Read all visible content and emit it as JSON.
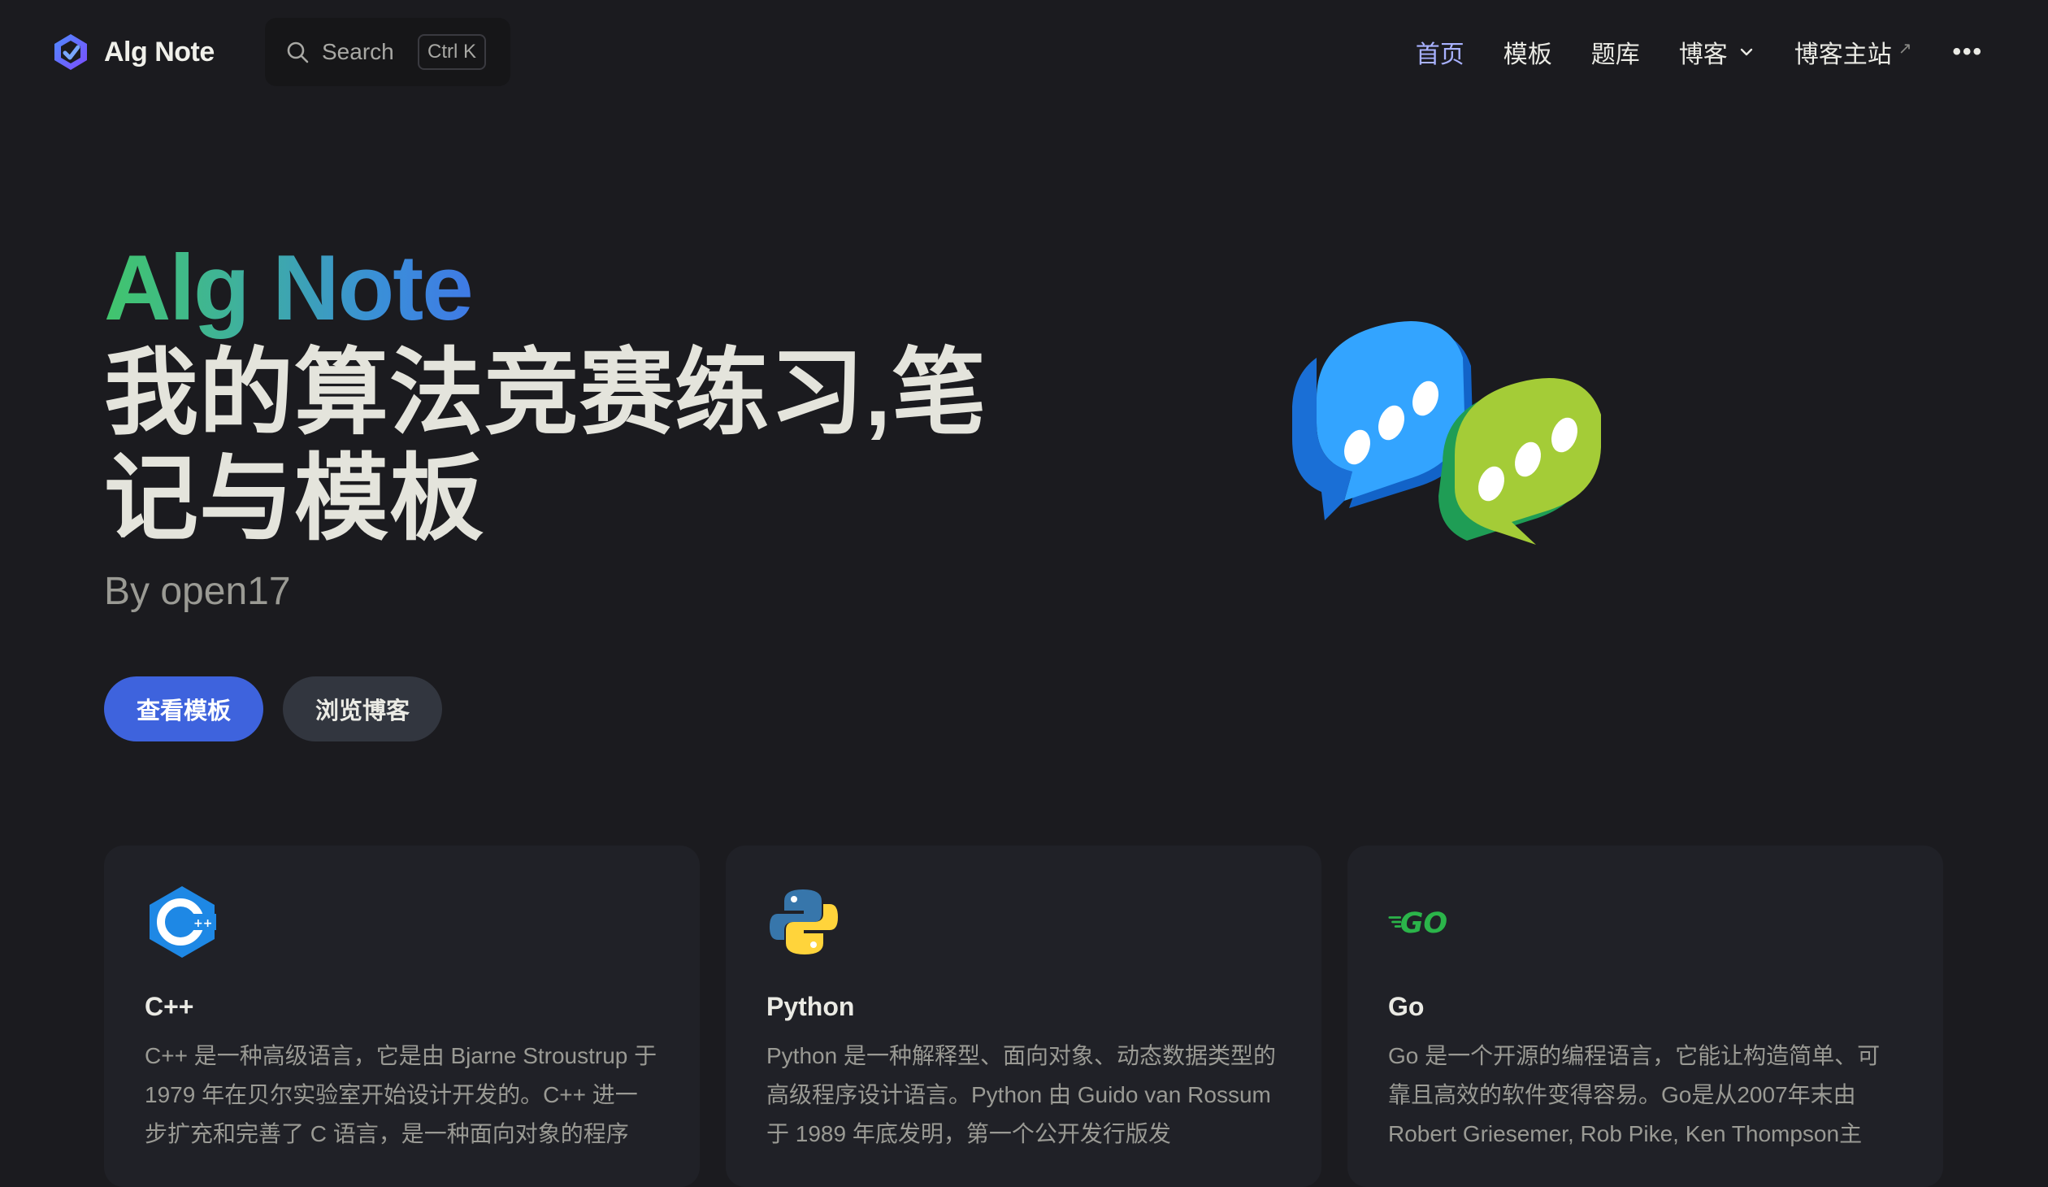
{
  "nav": {
    "brand": "Alg Note",
    "search_label": "Search",
    "search_kbd": "Ctrl K",
    "links": [
      {
        "label": "首页",
        "active": true
      },
      {
        "label": "模板"
      },
      {
        "label": "题库"
      },
      {
        "label": "博客",
        "dropdown": true
      },
      {
        "label": "博客主站",
        "external": true
      }
    ],
    "more": "•••"
  },
  "hero": {
    "name": "Alg Note",
    "text": "我的算法竞赛练习,笔记与模板",
    "tagline": "By open17",
    "actions": [
      {
        "label": "查看模板",
        "theme": "brand"
      },
      {
        "label": "浏览博客",
        "theme": "alt"
      }
    ]
  },
  "features": [
    {
      "icon": "cpp-icon",
      "title": "C++",
      "details": "C++ 是一种高级语言，它是由 Bjarne Stroustrup 于 1979 年在贝尔实验室开始设计开发的。C++ 进一步扩充和完善了 C 语言，是一种面向对象的程序"
    },
    {
      "icon": "python-icon",
      "title": "Python",
      "details": "Python 是一种解释型、面向对象、动态数据类型的高级程序设计语言。Python 由 Guido van Rossum 于 1989 年底发明，第一个公开发行版发"
    },
    {
      "icon": "go-icon",
      "title": "Go",
      "details": "Go 是一个开源的编程语言，它能让构造简单、可靠且高效的软件变得容易。Go是从2007年末由 Robert Griesemer, Rob Pike, Ken Thompson主"
    }
  ],
  "colors": {
    "background": "#1b1b1f",
    "brand": "#3e63dd",
    "active_link": "#a8b1ff",
    "card": "#202127"
  }
}
